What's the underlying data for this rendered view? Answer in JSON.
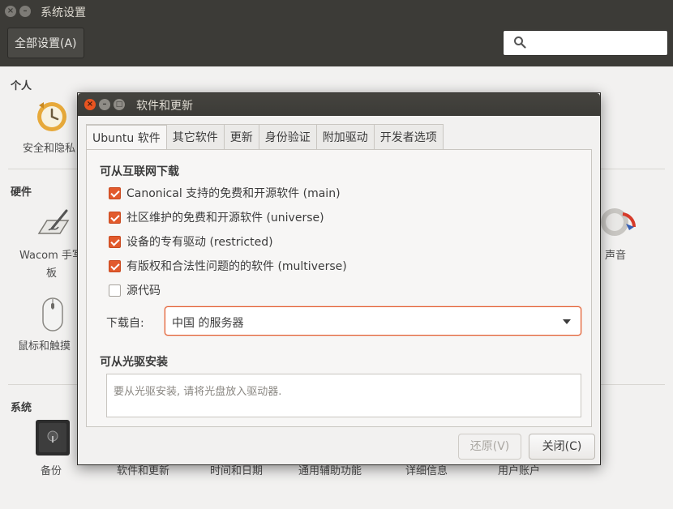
{
  "background_window": {
    "title": "系统设置",
    "toolbar": {
      "all_settings": "全部设置(A)",
      "search_placeholder": ""
    },
    "sections": {
      "personal": "个人",
      "hardware": "硬件",
      "system": "系统"
    },
    "apps": {
      "security": "安全和隐私",
      "wacom_line1": "Wacom 手写",
      "wacom_line2": "板",
      "sound": "声音",
      "mouse": "鼠标和触摸",
      "backup": "备份",
      "software": "软件和更新",
      "datetime": "时间和日期",
      "accessibility": "通用辅助功能",
      "details": "详细信息",
      "users": "用户账户"
    }
  },
  "dialog": {
    "title": "软件和更新",
    "tabs": [
      {
        "label": "Ubuntu 软件",
        "active": true
      },
      {
        "label": "其它软件",
        "active": false
      },
      {
        "label": "更新",
        "active": false
      },
      {
        "label": "身份验证",
        "active": false
      },
      {
        "label": "附加驱动",
        "active": false
      },
      {
        "label": "开发者选项",
        "active": false
      }
    ],
    "internet_group": {
      "title": "可从互联网下载",
      "options": [
        {
          "label": "Canonical 支持的免费和开源软件 (main)",
          "checked": true
        },
        {
          "label": "社区维护的免费和开源软件 (universe)",
          "checked": true
        },
        {
          "label": "设备的专有驱动 (restricted)",
          "checked": true
        },
        {
          "label": "有版权和合法性问题的的软件 (multiverse)",
          "checked": true
        },
        {
          "label": "源代码",
          "checked": false
        }
      ],
      "download_from_label": "下载自:",
      "download_from_value": "中国 的服务器"
    },
    "cdrom_group": {
      "title": "可从光驱安装",
      "placeholder": "要从光驱安装, 请将光盘放入驱动器."
    },
    "buttons": {
      "revert": "还原(V)",
      "close": "关闭(C)"
    }
  },
  "colors": {
    "accent": "#e95420",
    "checkbox": "#e25a2c",
    "titlebar": "#3c3b37"
  }
}
